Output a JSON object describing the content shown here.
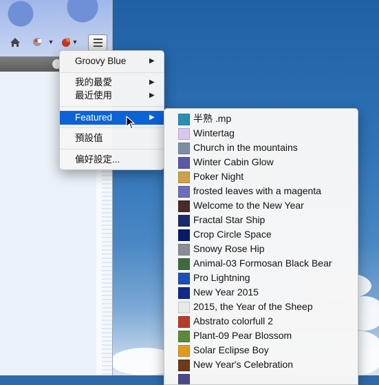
{
  "menu": {
    "current_theme": "Groovy Blue",
    "my_favorites": "我的最愛",
    "recently_used": "最近使用",
    "featured": "Featured",
    "default": "預設值",
    "preferences": "偏好設定..."
  },
  "featured_items": [
    {
      "label": "半熟 .mp",
      "thumb_color": "#2a8fb0"
    },
    {
      "label": "Wintertag",
      "thumb_color": "#d8c6f0"
    },
    {
      "label": "Church in the mountains",
      "thumb_color": "#7c8ea3"
    },
    {
      "label": "Winter Cabin Glow",
      "thumb_color": "#5b58a8"
    },
    {
      "label": "Poker Night",
      "thumb_color": "#c9a24a"
    },
    {
      "label": "frosted leaves with a magenta",
      "thumb_color": "#6b6fb8"
    },
    {
      "label": "Welcome to the New Year",
      "thumb_color": "#4a2a2a"
    },
    {
      "label": "Fractal Star Ship",
      "thumb_color": "#1b2a6b"
    },
    {
      "label": "Crop Circle Space",
      "thumb_color": "#0b1a66"
    },
    {
      "label": "Snowy Rose Hip",
      "thumb_color": "#8a8e94"
    },
    {
      "label": "Animal-03 Formosan Black Bear",
      "thumb_color": "#3e6b3a"
    },
    {
      "label": "Pro Lightning",
      "thumb_color": "#1a4fb8"
    },
    {
      "label": "New Year 2015",
      "thumb_color": "#0f2a8a"
    },
    {
      "label": "2015, the Year of the Sheep",
      "thumb_color": "#e8e8e8"
    },
    {
      "label": "Abstrato colorfull 2",
      "thumb_color": "#b83a2a"
    },
    {
      "label": "Plant-09 Pear Blossom",
      "thumb_color": "#5a8a3a"
    },
    {
      "label": "Solar Eclipse Boy",
      "thumb_color": "#e09a20"
    },
    {
      "label": "New Year's Celebration",
      "thumb_color": "#6a3a1a"
    },
    {
      "label": "",
      "thumb_color": "#4a4a8a"
    }
  ],
  "colors": {
    "highlight": "#0b63d6"
  }
}
